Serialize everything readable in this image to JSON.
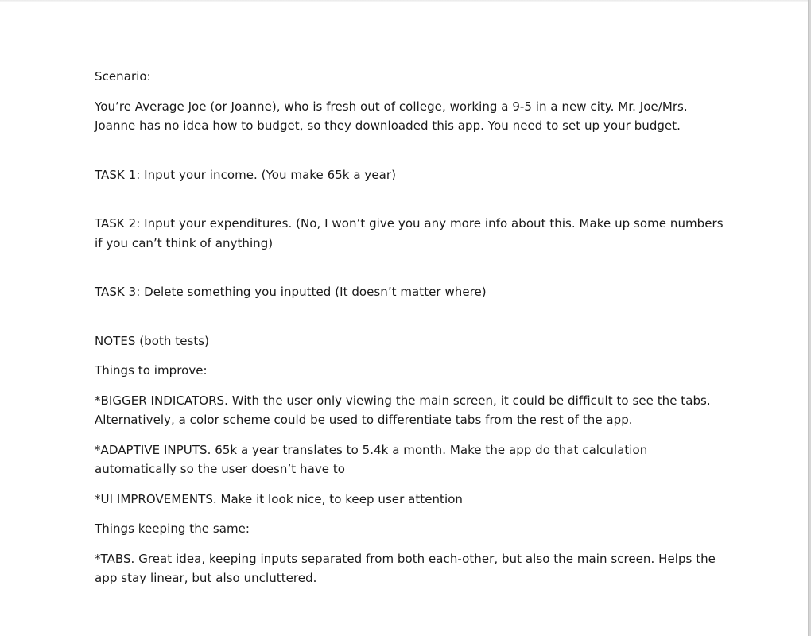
{
  "document": {
    "scenario_heading": "Scenario:",
    "scenario_text": "You’re Average Joe (or Joanne), who is fresh out of college, working a 9-5 in a new city. Mr. Joe/Mrs. Joanne has no idea how to budget, so they downloaded this app. You need to set up your budget.",
    "task1": "TASK 1: Input your income. (You make 65k a year)",
    "task2": "TASK 2: Input your expenditures. (No, I won’t give you any more info about this. Make up some numbers if you can’t think of anything)",
    "task3": "TASK 3: Delete something you inputted (It doesn’t matter where)",
    "notes_heading": "NOTES (both tests)",
    "improve_heading": "Things to improve:",
    "improve_1": "*BIGGER INDICATORS. With the user only viewing the main screen, it could be difficult to see the tabs. Alternatively, a color scheme could be used to differentiate tabs from the rest of the app.",
    "improve_2": "*ADAPTIVE INPUTS. 65k a year translates to 5.4k a month. Make the app do that calculation automatically so the user doesn’t have to",
    "improve_3": "*UI IMPROVEMENTS. Make it look nice, to keep user attention",
    "keep_heading": "Things keeping the same:",
    "keep_1": "*TABS. Great idea, keeping inputs separated from both each-other, but also the main screen. Helps the app stay linear, but also uncluttered."
  }
}
